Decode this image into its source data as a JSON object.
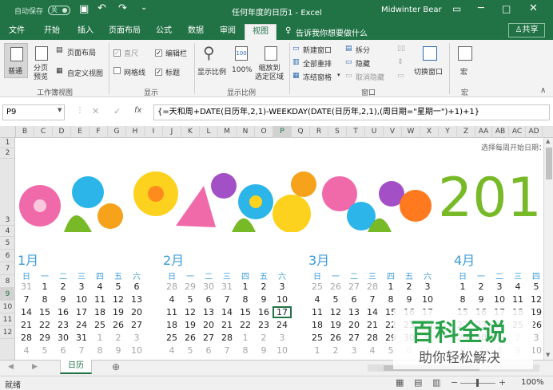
{
  "titlebar": {
    "autosave": "自动保存",
    "autosave_state": "关",
    "title": "任何年度的日历1 - Excel",
    "user": "Midwinter Bear"
  },
  "tabs": [
    "文件",
    "开始",
    "插入",
    "页面布局",
    "公式",
    "数据",
    "审阅",
    "视图"
  ],
  "tell_me": "告诉我你想要做什么",
  "share": "共享",
  "ribbon": {
    "views": {
      "normal": "普通",
      "pagebreak": "分页\n预览",
      "pagelayout": "页面布局",
      "custom": "自定义视图",
      "label": "工作簿视图"
    },
    "show": {
      "ruler": "直尺",
      "formulabar": "编辑栏",
      "gridlines": "网格线",
      "headings": "标题",
      "label": "显示"
    },
    "zoom": {
      "zoom": "显示比例",
      "z100": "100%",
      "selection": "缩放到\n选定区域",
      "label": "显示比例"
    },
    "window": {
      "new": "新建窗口",
      "arrange": "全部重排",
      "freeze": "冻结窗格",
      "split": "拆分",
      "hide": "隐藏",
      "unhide": "取消隐藏",
      "switch": "切换窗口",
      "label": "窗口"
    },
    "macro": {
      "macro": "宏",
      "label": "宏"
    }
  },
  "formula": {
    "namebox": "P9",
    "fx": "fx",
    "text": "{=天和周+DATE(日历年,2,1)-WEEKDAY(DATE(日历年,2,1),(周日期=\"星期一\")+1)+1}"
  },
  "columns": [
    "B",
    "C",
    "D",
    "E",
    "F",
    "G",
    "H",
    "I",
    "J",
    "K",
    "L",
    "M",
    "N",
    "O",
    "P",
    "Q",
    "R",
    "S",
    "T",
    "U",
    "V",
    "W",
    "X",
    "Y",
    "Z",
    "AA",
    "AB",
    "AC",
    "AD"
  ],
  "rows": [
    "1",
    "2",
    "3",
    "4",
    "5",
    "6",
    "7",
    "8",
    "9",
    "10",
    "11",
    "12"
  ],
  "sheet": {
    "hint": "选择每周开始日期：",
    "year": "201"
  },
  "months": [
    {
      "name": "1月",
      "dow": [
        "日",
        "一",
        "二",
        "三",
        "四",
        "五",
        "六"
      ],
      "weeks": [
        [
          "31",
          "1",
          "2",
          "3",
          "4",
          "5",
          "6"
        ],
        [
          "7",
          "8",
          "9",
          "10",
          "11",
          "12",
          "13"
        ],
        [
          "14",
          "15",
          "16",
          "17",
          "18",
          "19",
          "20"
        ],
        [
          "21",
          "22",
          "23",
          "24",
          "25",
          "26",
          "27"
        ],
        [
          "28",
          "29",
          "30",
          "31",
          "1",
          "2",
          "3"
        ],
        [
          "4",
          "5",
          "6",
          "7",
          "8",
          "9",
          "10"
        ]
      ]
    },
    {
      "name": "2月",
      "dow": [
        "日",
        "一",
        "二",
        "三",
        "四",
        "五",
        "六"
      ],
      "weeks": [
        [
          "28",
          "29",
          "30",
          "31",
          "1",
          "2",
          "3"
        ],
        [
          "4",
          "5",
          "6",
          "7",
          "8",
          "9",
          "10"
        ],
        [
          "11",
          "12",
          "13",
          "14",
          "15",
          "16",
          "17"
        ],
        [
          "18",
          "19",
          "20",
          "21",
          "22",
          "23",
          "24"
        ],
        [
          "25",
          "26",
          "27",
          "28",
          "1",
          "2",
          "3"
        ],
        [
          "4",
          "5",
          "6",
          "7",
          "8",
          "9",
          "10"
        ]
      ]
    },
    {
      "name": "3月",
      "dow": [
        "日",
        "一",
        "二",
        "三",
        "四",
        "五",
        "六"
      ],
      "weeks": [
        [
          "25",
          "26",
          "27",
          "28",
          "1",
          "2",
          "3"
        ],
        [
          "4",
          "5",
          "6",
          "7",
          "8",
          "9",
          "10"
        ],
        [
          "11",
          "12",
          "13",
          "14",
          "15",
          "16",
          "17"
        ],
        [
          "18",
          "19",
          "20",
          "21",
          "22",
          "23",
          "24"
        ],
        [
          "25",
          "26",
          "27",
          "28",
          "29",
          "30",
          "31"
        ],
        [
          "1",
          "2",
          "3",
          "4",
          "5",
          "6",
          "7"
        ]
      ]
    },
    {
      "name": "4月",
      "dow": [
        "日",
        "一",
        "二",
        "三",
        "四",
        "五",
        "六"
      ],
      "weeks": [
        [
          "1",
          "2",
          "3",
          "4",
          "5",
          "6",
          "7"
        ],
        [
          "8",
          "9",
          "10",
          "11",
          "12",
          "13",
          "14"
        ],
        [
          "15",
          "16",
          "17",
          "18",
          "19",
          "20",
          "21"
        ],
        [
          "22",
          "23",
          "24",
          "25",
          "26",
          "27",
          "28"
        ],
        [
          "29",
          "30",
          "1",
          "2",
          "3",
          "4",
          "5"
        ],
        [
          "6",
          "7",
          "8",
          "9",
          "10",
          "11",
          "12"
        ]
      ]
    }
  ],
  "sheettab": "日历",
  "status": {
    "ready": "就绪",
    "zoom": "100%"
  },
  "watermark": {
    "title": "百科全说",
    "sub": "助你轻松解决"
  }
}
